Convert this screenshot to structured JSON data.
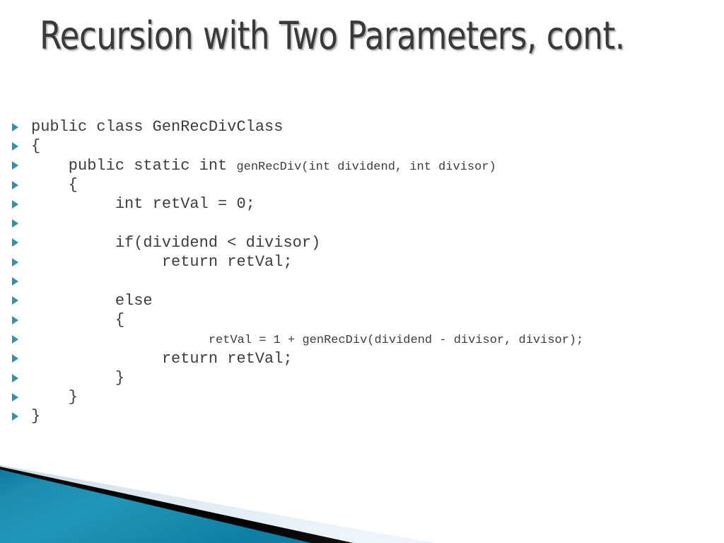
{
  "slide": {
    "title": "Recursion with Two Parameters, cont.",
    "background_color": "#ffffff",
    "title_color": "#393939",
    "code_color": "#3d3d3d",
    "bullet_color": "#2e93b2",
    "accent_teal": "#1b8cae",
    "accent_light_blue": "#dfe9f1",
    "accent_black": "#000000"
  },
  "code": {
    "language": "java",
    "lines": [
      {
        "text": "public class GenRecDivClass",
        "size": "normal"
      },
      {
        "text": "{",
        "size": "normal"
      },
      {
        "text": "    public static int ",
        "size": "normal",
        "tail": "genRecDiv(int dividend, int divisor)",
        "tail_size": "small"
      },
      {
        "text": "    {",
        "size": "normal"
      },
      {
        "text": "         int retVal = 0;",
        "size": "normal"
      },
      {
        "text": "",
        "size": "normal"
      },
      {
        "text": "         if(dividend < divisor)",
        "size": "normal"
      },
      {
        "text": "              return retVal;",
        "size": "normal"
      },
      {
        "text": "",
        "size": "normal"
      },
      {
        "text": "         else",
        "size": "normal"
      },
      {
        "text": "         {",
        "size": "normal"
      },
      {
        "text": "                   ",
        "size": "normal",
        "tail": "retVal = 1 + genRecDiv(dividend - divisor, divisor);",
        "tail_size": "small"
      },
      {
        "text": "              return retVal;",
        "size": "normal"
      },
      {
        "text": "         }",
        "size": "normal"
      },
      {
        "text": "    }",
        "size": "normal"
      },
      {
        "text": "}",
        "size": "normal"
      }
    ]
  }
}
